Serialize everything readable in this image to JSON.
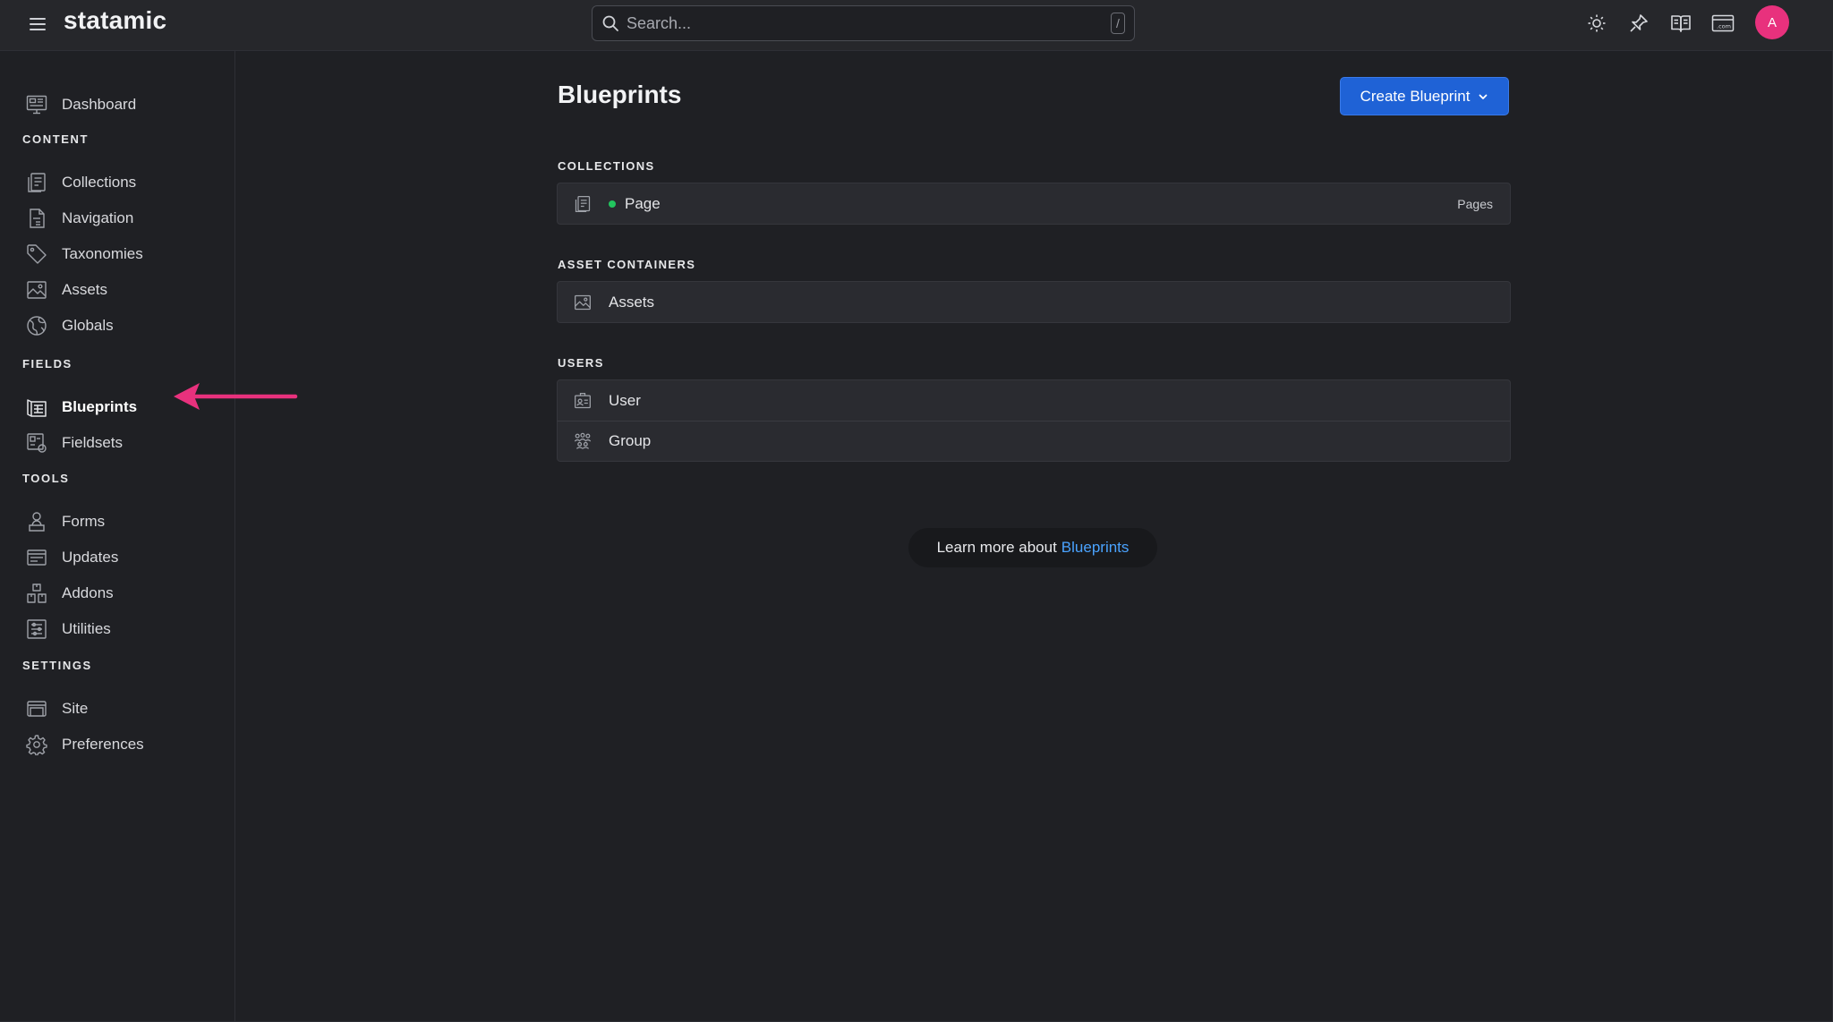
{
  "app": {
    "brand": "statamic",
    "search": {
      "placeholder": "Search...",
      "shortcut": "/"
    },
    "top_icons": [
      "theme-icon",
      "pin-icon",
      "docs-book-icon",
      "site-link-icon"
    ],
    "avatar_initial": "A",
    "avatar_color": "#e8317d"
  },
  "sidebar": {
    "dashboard": "Dashboard",
    "sections": [
      {
        "title": "CONTENT",
        "items": [
          "Collections",
          "Navigation",
          "Taxonomies",
          "Assets",
          "Globals"
        ]
      },
      {
        "title": "FIELDS",
        "items": [
          "Blueprints",
          "Fieldsets"
        ]
      },
      {
        "title": "TOOLS",
        "items": [
          "Forms",
          "Updates",
          "Addons",
          "Utilities"
        ]
      },
      {
        "title": "SETTINGS",
        "items": [
          "Site",
          "Preferences"
        ]
      }
    ],
    "active_item": "Blueprints"
  },
  "annotation": {
    "arrow_color": "#e8317d",
    "points_to": "Blueprints"
  },
  "main": {
    "title": "Blueprints",
    "create_button": "Create Blueprint",
    "groups": [
      {
        "title": "COLLECTIONS",
        "rows": [
          {
            "label": "Page",
            "meta": "Pages",
            "status": "published"
          }
        ]
      },
      {
        "title": "ASSET CONTAINERS",
        "rows": [
          {
            "label": "Assets"
          }
        ]
      },
      {
        "title": "USERS",
        "rows": [
          {
            "label": "User"
          },
          {
            "label": "Group"
          }
        ]
      }
    ],
    "learn_more": {
      "text": "Learn more about",
      "link": "Blueprints"
    }
  },
  "colors": {
    "background": "#1f2024",
    "topbar": "#26272b",
    "accent_button": "#1f62d6",
    "link": "#4aa3ff",
    "status_dot": "#22c55e"
  }
}
